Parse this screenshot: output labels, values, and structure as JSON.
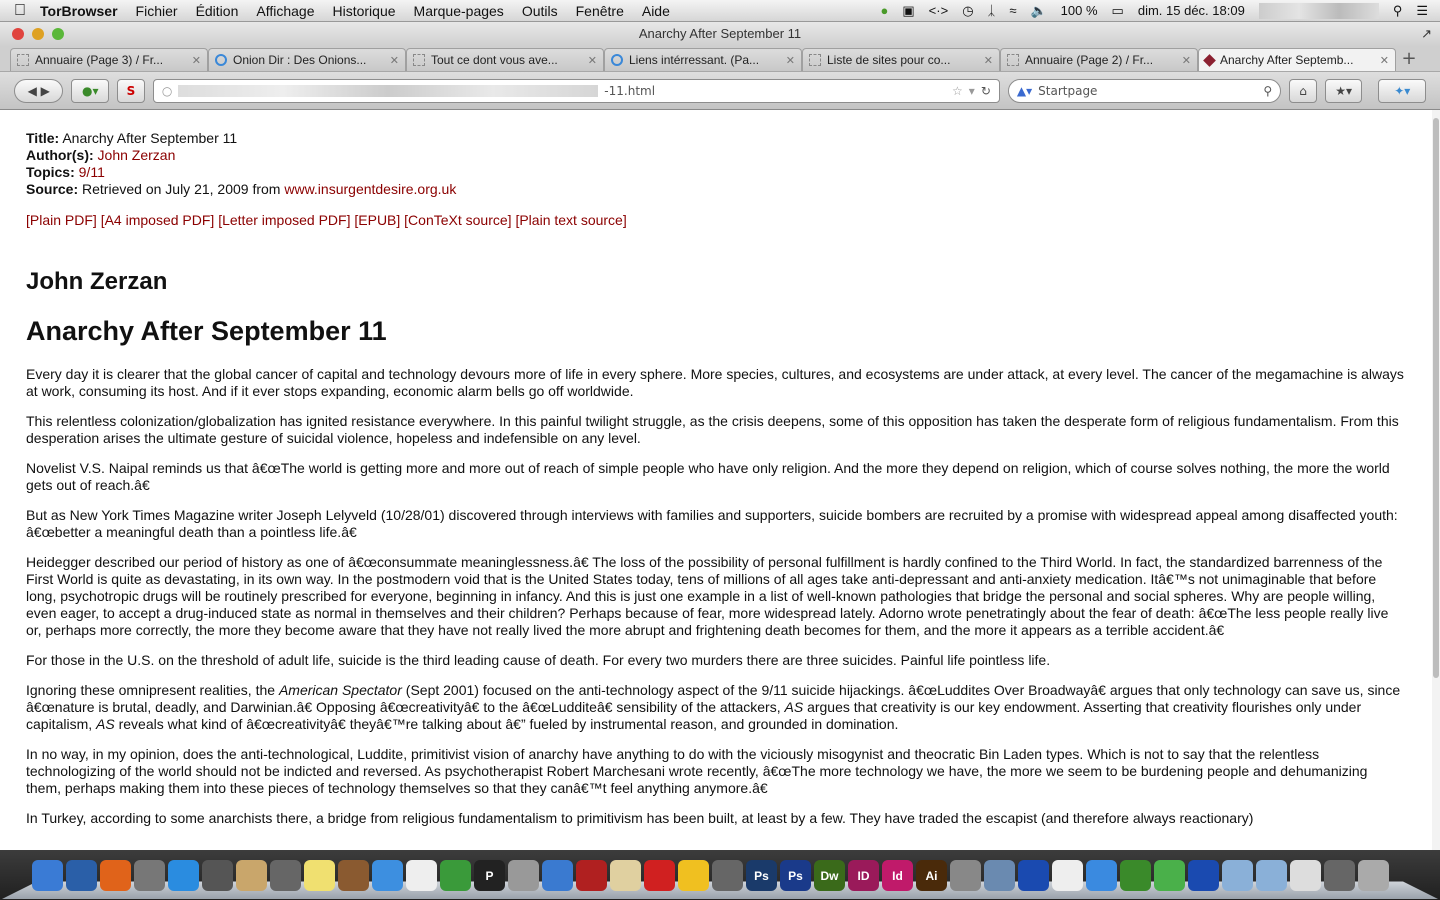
{
  "menubar": {
    "app": "TorBrowser",
    "items": [
      "Fichier",
      "Édition",
      "Affichage",
      "Historique",
      "Marque-pages",
      "Outils",
      "Fenêtre",
      "Aide"
    ],
    "battery": "100 %",
    "clock": "dim. 15 déc.  18:09"
  },
  "window": {
    "title": "Anarchy After September 11"
  },
  "tabs": [
    {
      "label": "Annuaire (Page 3) / Fr...",
      "icon": "blank"
    },
    {
      "label": "Onion Dir : Des Onions...",
      "icon": "onion"
    },
    {
      "label": "Tout ce dont vous ave...",
      "icon": "blank"
    },
    {
      "label": "Liens intérressant. (Pa...",
      "icon": "onion"
    },
    {
      "label": "Liste de sites pour co...",
      "icon": "blank"
    },
    {
      "label": "Annuaire (Page 2) / Fr...",
      "icon": "blank"
    },
    {
      "label": "Anarchy After Septemb...",
      "icon": "book",
      "active": true
    }
  ],
  "navbar": {
    "url_suffix": "-11.html",
    "search_placeholder": "Startpage"
  },
  "article": {
    "meta": {
      "title_label": "Title:",
      "title": "Anarchy After September 11",
      "author_label": "Author(s):",
      "author": "John Zerzan",
      "topics_label": "Topics:",
      "topics": "9/11",
      "source_label": "Source:",
      "source_text": "Retrieved on July 21, 2009 from",
      "source_link": "www.insurgentdesire.org.uk"
    },
    "downloads": [
      "[Plain PDF]",
      "[A4 imposed PDF]",
      "[Letter imposed PDF]",
      "[EPUB]",
      "[ConTeXt source]",
      "[Plain text source]"
    ],
    "author_heading": "John Zerzan",
    "heading": "Anarchy After September 11",
    "paragraphs": [
      "Every day it is clearer that the global cancer of capital and technology devours more of life in every sphere. More species, cultures, and ecosystems are under attack, at every level. The cancer of the megamachine is always at work, consuming its host. And if it ever stops expanding, economic alarm bells go off worldwide.",
      "This relentless colonization/globalization has ignited resistance everywhere. In this painful twilight struggle, as the crisis deepens, some of this opposition has taken the desperate form of religious fundamentalism. From this desperation arises the ultimate gesture of suicidal violence, hopeless and indefensible on any level.",
      "Novelist V.S. Naipal reminds us that â€œThe world is getting more and more out of reach of simple people who have only religion. And the more they depend on religion, which of course solves nothing, the more the world gets out of reach.â€",
      "But as New York Times Magazine writer Joseph Lelyveld (10/28/01) discovered through interviews with families and supporters, suicide bombers are recruited by a promise with widespread appeal among disaffected youth: â€œbetter a meaningful death than a pointless life.â€",
      "Heidegger described our period of history as one of â€œconsummate meaninglessness.â€ The loss of the possibility of personal fulfillment is hardly confined to the Third World. In fact, the standardized barrenness of the First World is quite as devastating, in its own way. In the postmodern void that is the United States today, tens of millions of all ages take anti-depressant and anti-anxiety medication. Itâ€™s not unimaginable that before long, psychotropic drugs will be routinely prescribed for everyone, beginning in infancy. And this is just one example in a list of well-known pathologies that bridge the personal and social spheres. Why are people willing, even eager, to accept a drug-induced state as normal in themselves and their children? Perhaps because of fear, more widespread lately. Adorno wrote penetratingly about the fear of death: â€œThe less people really live or, perhaps more correctly, the more they become aware that they have not really lived the more abrupt and frightening death becomes for them, and the more it appears as a terrible accident.â€",
      "For those in the U.S. on the threshold of adult life, suicide is the third leading cause of death. For every two murders there are three suicides. Painful life pointless life."
    ],
    "p7": {
      "a": "Ignoring these omnipresent realities, the ",
      "i1": "American Spectator",
      "b": " (Sept 2001) focused on the anti-technology aspect of the 9/11 suicide hijackings. â€œLuddites Over Broadwayâ€ argues that only technology can save us, since â€œnature is brutal, deadly, and Darwinian.â€ Opposing â€œcreativityâ€ to the â€œLudditeâ€ sensibility of the attackers, ",
      "i2": "AS",
      "c": " argues that creativity is our key endowment. Asserting that creativity flourishes only under capitalism, ",
      "i3": "AS",
      "d": " reveals what kind of â€œcreativityâ€ theyâ€™re talking about â€” fueled by instrumental reason, and grounded in domination."
    },
    "p8": "In no way, in my opinion, does the anti-technological, Luddite, primitivist vision of anarchy have anything to do with the viciously misogynist and theocratic Bin Laden types. Which is not to say that the relentless technologizing of the world should not be indicted and reversed. As psychotherapist Robert Marchesani wrote recently, â€œThe more technology we have, the more we seem to be burdening people and dehumanizing them, perhaps making them into these pieces of technology themselves so that they canâ€™t feel anything anymore.â€",
    "p9": "In Turkey, according to some anarchists there, a bridge from religious fundamentalism to primitivism has been built, at least by a few. They have traded the escapist (and therefore always reactionary)"
  },
  "dock": [
    {
      "name": "finder",
      "color": "#3a7bd5"
    },
    {
      "name": "thunderbird",
      "color": "#2a5fa8"
    },
    {
      "name": "firefox",
      "color": "#e0631a"
    },
    {
      "name": "launchpad",
      "color": "#777"
    },
    {
      "name": "app-store",
      "color": "#2a8ce0"
    },
    {
      "name": "image-capture",
      "color": "#555"
    },
    {
      "name": "contacts",
      "color": "#c9a66b"
    },
    {
      "name": "unknown",
      "color": "#666"
    },
    {
      "name": "stickies",
      "color": "#f0e070"
    },
    {
      "name": "keynote",
      "color": "#8a5a30"
    },
    {
      "name": "dropbox",
      "color": "#3d8fe0"
    },
    {
      "name": "calendar",
      "color": "#eee"
    },
    {
      "name": "numbers",
      "color": "#3a9a3a"
    },
    {
      "name": "p-app",
      "color": "#222",
      "label": "P"
    },
    {
      "name": "preview",
      "color": "#999"
    },
    {
      "name": "itunes",
      "color": "#3a7ad0"
    },
    {
      "name": "photo-booth",
      "color": "#b02020"
    },
    {
      "name": "textedit",
      "color": "#e0d0a0"
    },
    {
      "name": "star-app",
      "color": "#d02020"
    },
    {
      "name": "cyberduck",
      "color": "#f0c020"
    },
    {
      "name": "unknown-2",
      "color": "#666"
    },
    {
      "name": "photoshop",
      "color": "#1a3a6a",
      "label": "Ps"
    },
    {
      "name": "photoshop-2",
      "color": "#1a3a8a",
      "label": "Ps"
    },
    {
      "name": "dreamweaver",
      "color": "#3a6a1a",
      "label": "Dw"
    },
    {
      "name": "indesign",
      "color": "#9a1a5a",
      "label": "ID"
    },
    {
      "name": "indesign-2",
      "color": "#c01a6a",
      "label": "Id"
    },
    {
      "name": "illustrator",
      "color": "#4a2a0a",
      "label": "Ai"
    },
    {
      "name": "automator",
      "color": "#888"
    },
    {
      "name": "preview-2",
      "color": "#6a8ab0"
    },
    {
      "name": "app-blue",
      "color": "#1a4ab0"
    },
    {
      "name": "document",
      "color": "#eee"
    },
    {
      "name": "safari",
      "color": "#3a8ae0"
    },
    {
      "name": "tor",
      "color": "#3a8a2a"
    },
    {
      "name": "globe",
      "color": "#4ab04a"
    },
    {
      "name": "app-blue-2",
      "color": "#1a4ab0"
    },
    {
      "name": "folder",
      "color": "#8ab0d8"
    },
    {
      "name": "folder-2",
      "color": "#8ab0d8"
    },
    {
      "name": "screenshot",
      "color": "#ddd"
    },
    {
      "name": "window",
      "color": "#666"
    },
    {
      "name": "trash",
      "color": "#aaa"
    }
  ]
}
